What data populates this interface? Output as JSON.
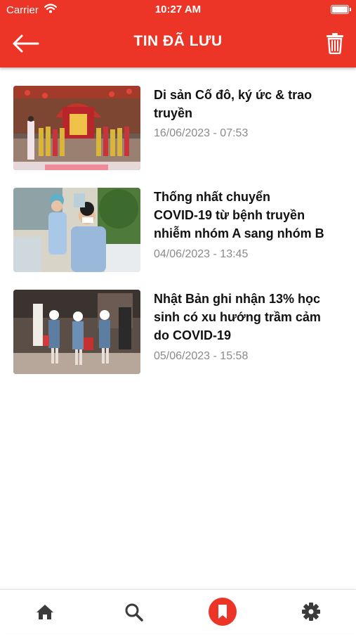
{
  "status_bar": {
    "carrier": "Carrier",
    "time": "10:27 AM"
  },
  "header": {
    "title": "TIN ĐÃ LƯU",
    "back_icon": "arrow-left-icon",
    "delete_icon": "trash-icon"
  },
  "colors": {
    "brand": "#ec3527",
    "title_text": "#111111",
    "date_text": "#8a8a8a"
  },
  "articles": [
    {
      "title_lines": [
        "Di sản Cố đô, ký ức & trao",
        "truyền"
      ],
      "date": "16/06/2023 - 07:53",
      "image": "hue-ceremony-photo"
    },
    {
      "title_lines": [
        "Thống nhất chuyển",
        "COVID-19 từ bệnh truyền",
        "nhiễm nhóm A sang nhóm B"
      ],
      "date": "04/06/2023 - 13:45",
      "image": "vaccination-photo"
    },
    {
      "title_lines": [
        "Nhật Bản ghi nhận 13% học",
        "sinh có xu hướng trầm cảm",
        "do COVID-19"
      ],
      "date": "05/06/2023 - 15:58",
      "image": "japan-students-photo"
    }
  ],
  "tabbar": {
    "active": "saved",
    "items": [
      {
        "id": "home",
        "icon": "home-icon"
      },
      {
        "id": "search",
        "icon": "search-icon"
      },
      {
        "id": "saved",
        "icon": "bookmark-icon"
      },
      {
        "id": "settings",
        "icon": "gear-icon"
      }
    ]
  }
}
